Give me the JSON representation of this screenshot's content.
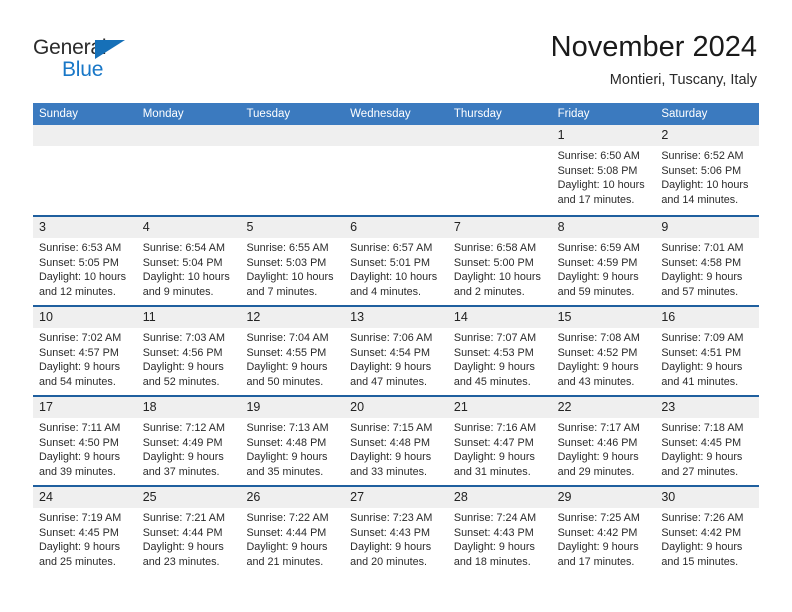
{
  "logo": {
    "word_general": "General",
    "word_blue": "Blue",
    "triangle_color": "#1670b8",
    "blue_color": "#1877c7"
  },
  "header": {
    "title": "November 2024",
    "subtitle": "Montieri, Tuscany, Italy"
  },
  "theme": {
    "header_row_bg": "#3b7abf",
    "header_row_text": "#ffffff",
    "week_divider": "#1f5f9e",
    "daynum_band_bg": "#efefef",
    "page_bg": "#ffffff"
  },
  "weekdays": [
    "Sunday",
    "Monday",
    "Tuesday",
    "Wednesday",
    "Thursday",
    "Friday",
    "Saturday"
  ],
  "labels": {
    "sunrise_prefix": "Sunrise:",
    "sunset_prefix": "Sunset:",
    "daylight_prefix": "Daylight:"
  },
  "weeks": [
    [
      {
        "day": "",
        "sunrise": "",
        "sunset": "",
        "daylight": ""
      },
      {
        "day": "",
        "sunrise": "",
        "sunset": "",
        "daylight": ""
      },
      {
        "day": "",
        "sunrise": "",
        "sunset": "",
        "daylight": ""
      },
      {
        "day": "",
        "sunrise": "",
        "sunset": "",
        "daylight": ""
      },
      {
        "day": "",
        "sunrise": "",
        "sunset": "",
        "daylight": ""
      },
      {
        "day": "1",
        "sunrise": "Sunrise: 6:50 AM",
        "sunset": "Sunset: 5:08 PM",
        "daylight": "Daylight: 10 hours and 17 minutes."
      },
      {
        "day": "2",
        "sunrise": "Sunrise: 6:52 AM",
        "sunset": "Sunset: 5:06 PM",
        "daylight": "Daylight: 10 hours and 14 minutes."
      }
    ],
    [
      {
        "day": "3",
        "sunrise": "Sunrise: 6:53 AM",
        "sunset": "Sunset: 5:05 PM",
        "daylight": "Daylight: 10 hours and 12 minutes."
      },
      {
        "day": "4",
        "sunrise": "Sunrise: 6:54 AM",
        "sunset": "Sunset: 5:04 PM",
        "daylight": "Daylight: 10 hours and 9 minutes."
      },
      {
        "day": "5",
        "sunrise": "Sunrise: 6:55 AM",
        "sunset": "Sunset: 5:03 PM",
        "daylight": "Daylight: 10 hours and 7 minutes."
      },
      {
        "day": "6",
        "sunrise": "Sunrise: 6:57 AM",
        "sunset": "Sunset: 5:01 PM",
        "daylight": "Daylight: 10 hours and 4 minutes."
      },
      {
        "day": "7",
        "sunrise": "Sunrise: 6:58 AM",
        "sunset": "Sunset: 5:00 PM",
        "daylight": "Daylight: 10 hours and 2 minutes."
      },
      {
        "day": "8",
        "sunrise": "Sunrise: 6:59 AM",
        "sunset": "Sunset: 4:59 PM",
        "daylight": "Daylight: 9 hours and 59 minutes."
      },
      {
        "day": "9",
        "sunrise": "Sunrise: 7:01 AM",
        "sunset": "Sunset: 4:58 PM",
        "daylight": "Daylight: 9 hours and 57 minutes."
      }
    ],
    [
      {
        "day": "10",
        "sunrise": "Sunrise: 7:02 AM",
        "sunset": "Sunset: 4:57 PM",
        "daylight": "Daylight: 9 hours and 54 minutes."
      },
      {
        "day": "11",
        "sunrise": "Sunrise: 7:03 AM",
        "sunset": "Sunset: 4:56 PM",
        "daylight": "Daylight: 9 hours and 52 minutes."
      },
      {
        "day": "12",
        "sunrise": "Sunrise: 7:04 AM",
        "sunset": "Sunset: 4:55 PM",
        "daylight": "Daylight: 9 hours and 50 minutes."
      },
      {
        "day": "13",
        "sunrise": "Sunrise: 7:06 AM",
        "sunset": "Sunset: 4:54 PM",
        "daylight": "Daylight: 9 hours and 47 minutes."
      },
      {
        "day": "14",
        "sunrise": "Sunrise: 7:07 AM",
        "sunset": "Sunset: 4:53 PM",
        "daylight": "Daylight: 9 hours and 45 minutes."
      },
      {
        "day": "15",
        "sunrise": "Sunrise: 7:08 AM",
        "sunset": "Sunset: 4:52 PM",
        "daylight": "Daylight: 9 hours and 43 minutes."
      },
      {
        "day": "16",
        "sunrise": "Sunrise: 7:09 AM",
        "sunset": "Sunset: 4:51 PM",
        "daylight": "Daylight: 9 hours and 41 minutes."
      }
    ],
    [
      {
        "day": "17",
        "sunrise": "Sunrise: 7:11 AM",
        "sunset": "Sunset: 4:50 PM",
        "daylight": "Daylight: 9 hours and 39 minutes."
      },
      {
        "day": "18",
        "sunrise": "Sunrise: 7:12 AM",
        "sunset": "Sunset: 4:49 PM",
        "daylight": "Daylight: 9 hours and 37 minutes."
      },
      {
        "day": "19",
        "sunrise": "Sunrise: 7:13 AM",
        "sunset": "Sunset: 4:48 PM",
        "daylight": "Daylight: 9 hours and 35 minutes."
      },
      {
        "day": "20",
        "sunrise": "Sunrise: 7:15 AM",
        "sunset": "Sunset: 4:48 PM",
        "daylight": "Daylight: 9 hours and 33 minutes."
      },
      {
        "day": "21",
        "sunrise": "Sunrise: 7:16 AM",
        "sunset": "Sunset: 4:47 PM",
        "daylight": "Daylight: 9 hours and 31 minutes."
      },
      {
        "day": "22",
        "sunrise": "Sunrise: 7:17 AM",
        "sunset": "Sunset: 4:46 PM",
        "daylight": "Daylight: 9 hours and 29 minutes."
      },
      {
        "day": "23",
        "sunrise": "Sunrise: 7:18 AM",
        "sunset": "Sunset: 4:45 PM",
        "daylight": "Daylight: 9 hours and 27 minutes."
      }
    ],
    [
      {
        "day": "24",
        "sunrise": "Sunrise: 7:19 AM",
        "sunset": "Sunset: 4:45 PM",
        "daylight": "Daylight: 9 hours and 25 minutes."
      },
      {
        "day": "25",
        "sunrise": "Sunrise: 7:21 AM",
        "sunset": "Sunset: 4:44 PM",
        "daylight": "Daylight: 9 hours and 23 minutes."
      },
      {
        "day": "26",
        "sunrise": "Sunrise: 7:22 AM",
        "sunset": "Sunset: 4:44 PM",
        "daylight": "Daylight: 9 hours and 21 minutes."
      },
      {
        "day": "27",
        "sunrise": "Sunrise: 7:23 AM",
        "sunset": "Sunset: 4:43 PM",
        "daylight": "Daylight: 9 hours and 20 minutes."
      },
      {
        "day": "28",
        "sunrise": "Sunrise: 7:24 AM",
        "sunset": "Sunset: 4:43 PM",
        "daylight": "Daylight: 9 hours and 18 minutes."
      },
      {
        "day": "29",
        "sunrise": "Sunrise: 7:25 AM",
        "sunset": "Sunset: 4:42 PM",
        "daylight": "Daylight: 9 hours and 17 minutes."
      },
      {
        "day": "30",
        "sunrise": "Sunrise: 7:26 AM",
        "sunset": "Sunset: 4:42 PM",
        "daylight": "Daylight: 9 hours and 15 minutes."
      }
    ]
  ]
}
